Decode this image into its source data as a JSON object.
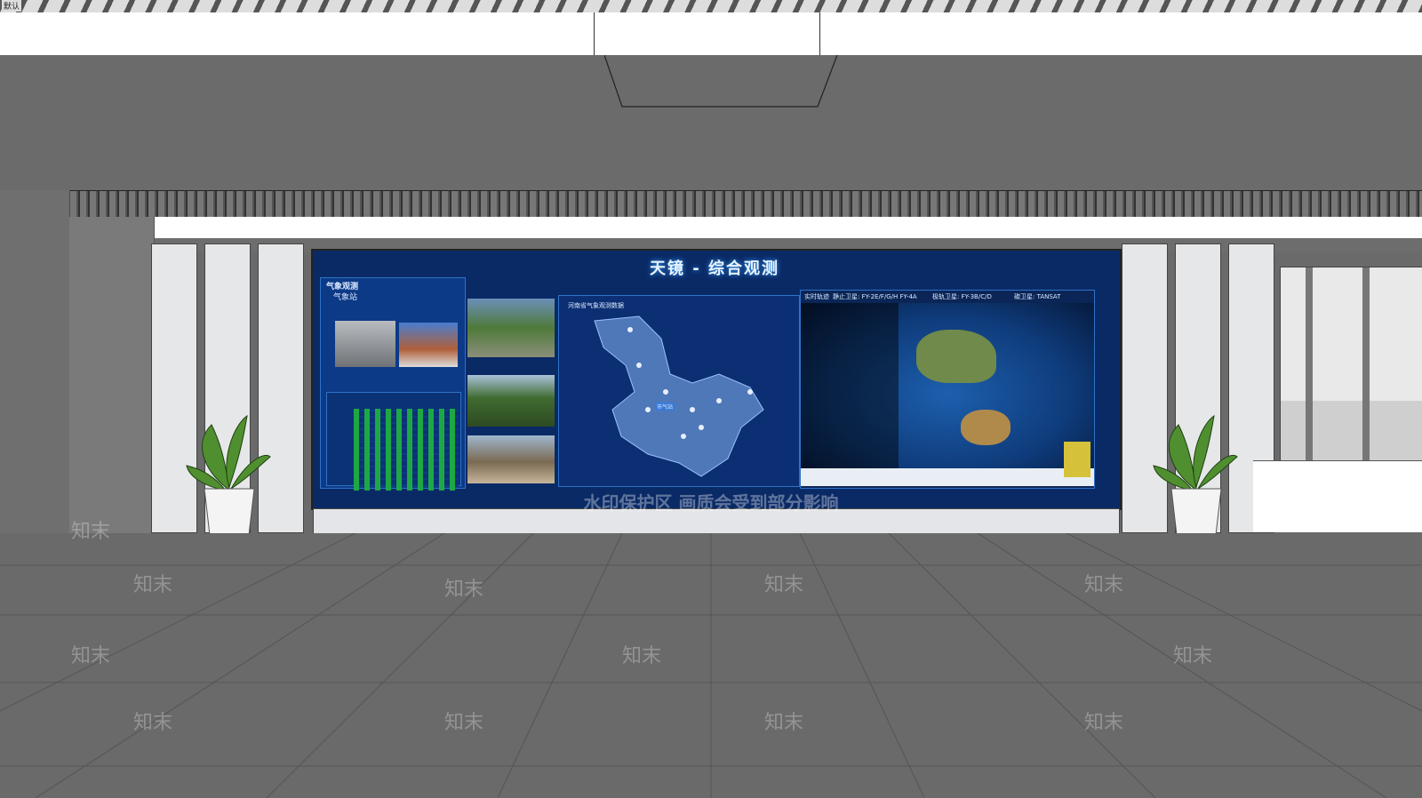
{
  "corner_tag": "默认",
  "screen": {
    "title": "天镜 - 综合观测",
    "left_panel": {
      "heading": "气象观测",
      "subheading": "气象站"
    },
    "map_panel": {
      "heading": "河南省气象观测数据",
      "marker_label": "市气站"
    },
    "satellite_panel": {
      "heading": "实时轨迹",
      "geo_sats": "静止卫星: FY-2E/F/G/H  FY-4A",
      "polar_sats": "极轨卫星: FY-3B/C/D",
      "other_sats": "碳卫星: TANSAT"
    }
  },
  "watermark": {
    "banner": "水印保护区  画质会受到部分影响",
    "tile": "知末"
  },
  "colors": {
    "screen_bg": "#0a2a66",
    "panel_bg": "#0d3a86",
    "accent": "#2f72c8",
    "bar_green": "#1ea844"
  }
}
